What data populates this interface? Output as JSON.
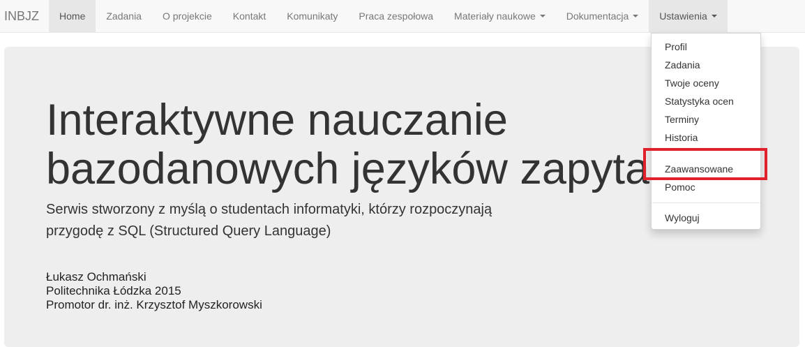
{
  "navbar": {
    "brand": "INBJZ",
    "items": [
      {
        "label": "Home"
      },
      {
        "label": "Zadania"
      },
      {
        "label": "O projekcie"
      },
      {
        "label": "Kontakt"
      },
      {
        "label": "Komunikaty"
      },
      {
        "label": "Praca zespołowa"
      },
      {
        "label": "Materiały naukowe"
      },
      {
        "label": "Dokumentacja"
      },
      {
        "label": "Ustawienia"
      }
    ]
  },
  "hero": {
    "title_line1": "Interaktywne nauczanie",
    "title_line2": "bazodanowych języków zapytań",
    "subtitle_line1": "Serwis stworzony z myślą o studentach informatyki, którzy rozpoczynają",
    "subtitle_line2": "przygodę z SQL (Structured Query Language)",
    "author": "Łukasz Ochmański",
    "affiliation": "Politechnika Łódzka 2015",
    "promoter": "Promotor dr. inż. Krzysztof Myszkorowski"
  },
  "settings_menu": {
    "items": [
      {
        "label": "Profil"
      },
      {
        "label": "Zadania"
      },
      {
        "label": "Twoje oceny"
      },
      {
        "label": "Statystyka ocen"
      },
      {
        "label": "Terminy"
      },
      {
        "label": "Historia"
      },
      {
        "label": "Zaawansowane"
      },
      {
        "label": "Pomoc"
      },
      {
        "label": "Wyloguj"
      }
    ]
  },
  "colors": {
    "highlight": "#e0202a",
    "navbar_bg": "#f8f8f8",
    "jumbotron_bg": "#eeeeee"
  }
}
